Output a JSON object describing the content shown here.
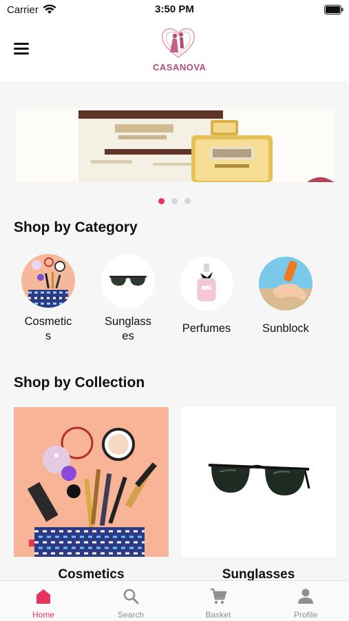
{
  "status": {
    "carrier": "Carrier",
    "time": "3:50 PM"
  },
  "header": {
    "logo_text": "CASANOVA",
    "menu_icon": "hamburger-icon"
  },
  "banner": {
    "slide_count": 3,
    "active_index": 0
  },
  "category_section": {
    "title": "Shop by Category",
    "items": [
      {
        "label": "Cosmetic\ns",
        "icon": "cosmetics"
      },
      {
        "label": "Sunglass\nes",
        "icon": "sunglasses"
      },
      {
        "label": "Perfumes",
        "icon": "perfume"
      },
      {
        "label": "Sunblock",
        "icon": "sunblock"
      }
    ]
  },
  "collection_section": {
    "title": "Shop by Collection",
    "items": [
      {
        "label": "Cosmetics"
      },
      {
        "label": "Sunglasses"
      }
    ]
  },
  "tabbar": {
    "tabs": [
      {
        "label": "Home",
        "icon": "home-icon"
      },
      {
        "label": "Search",
        "icon": "search-icon"
      },
      {
        "label": "Basket",
        "icon": "cart-icon"
      },
      {
        "label": "Profile",
        "icon": "person-icon"
      }
    ],
    "active_index": 0
  },
  "colors": {
    "accent": "#e8335a",
    "brand": "#b14d7a",
    "background": "#f6f6f6"
  }
}
